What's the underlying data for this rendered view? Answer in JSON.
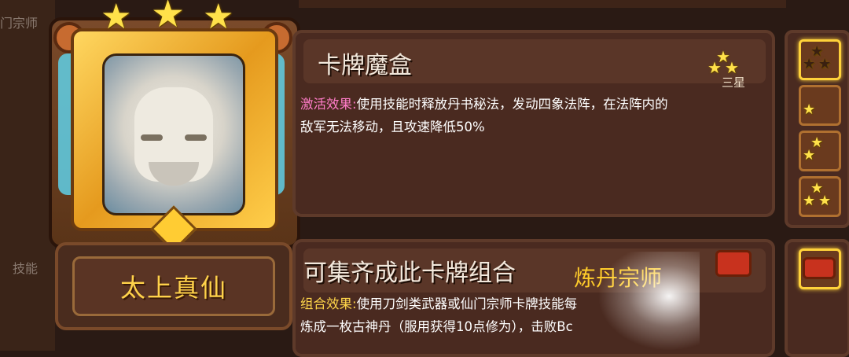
{
  "background": {
    "left_text_top": "门宗师",
    "left_text_mid": "技能"
  },
  "card": {
    "name": "太上真仙",
    "stars": 3,
    "frame_color": "#e59a1e",
    "accent_color": "#5fd0e8"
  },
  "card_info": {
    "title": "卡牌魔盒",
    "star_label": "三星",
    "effect_label": "激活效果:",
    "effect_text_line1": "使用技能时释放丹书秘法，发动四象法阵，在法阵内的",
    "effect_text_line2": "敌军无法移动，且攻速降低50%"
  },
  "combo": {
    "title": "可集齐成此卡牌组合",
    "combo_name": "炼丹宗师",
    "effect_label": "组合效果:",
    "effect_text_line1": "使用刀剑类武器或仙门宗师卡牌技能每",
    "effect_text_line2": "炼成一枚古神丹（服用获得10点修为），击败Bc"
  },
  "tiers": [
    {
      "stars": 3,
      "selected": true,
      "icon": "star-tier-icon"
    },
    {
      "stars": 1,
      "selected": false,
      "icon": "star-tier-icon"
    },
    {
      "stars": 2,
      "selected": false,
      "icon": "star-tier-icon"
    },
    {
      "stars": 3,
      "selected": false,
      "icon": "star-tier-icon"
    }
  ],
  "colors": {
    "label_pink": "#ff7cc8",
    "label_gold": "#ffd64a",
    "name_gold": "#ffd24a",
    "panel_bg": "#4a2a20"
  }
}
